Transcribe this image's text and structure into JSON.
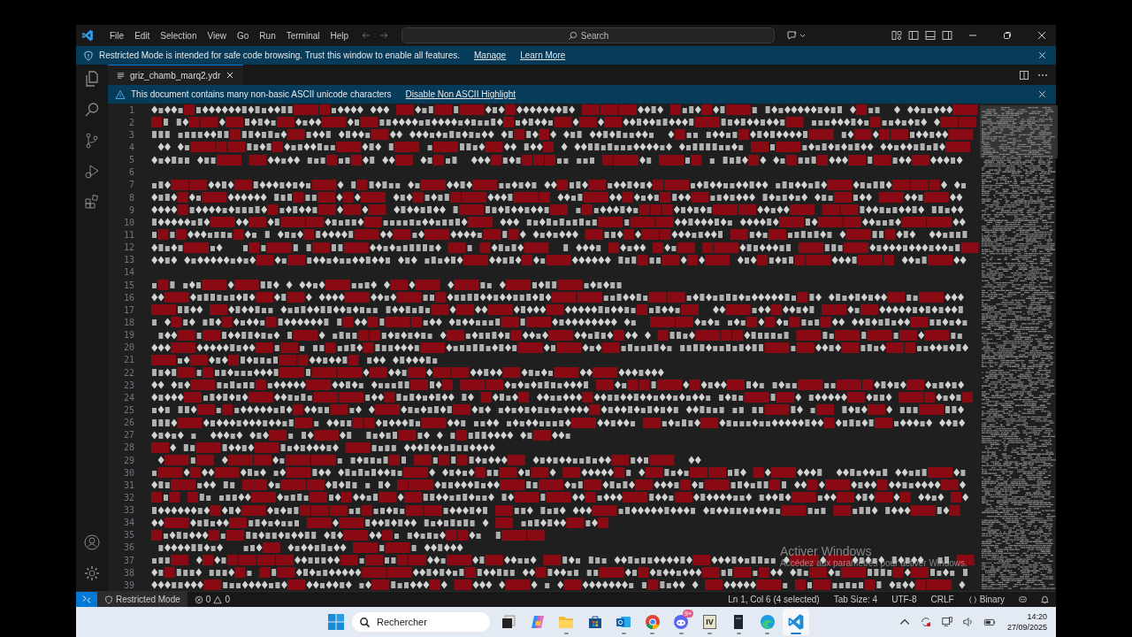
{
  "menu": [
    "File",
    "Edit",
    "Selection",
    "View",
    "Go",
    "Run",
    "Terminal",
    "Help"
  ],
  "search": {
    "placeholder": "Search"
  },
  "restricted_banner": {
    "text": "Restricted Mode is intended for safe code browsing. Trust this window to enable all features.",
    "links": [
      "Manage",
      "Learn More"
    ]
  },
  "tabs": [
    {
      "label": "griz_chamb_marq2.ydr",
      "selected": true
    }
  ],
  "ascii_banner": {
    "text": "This document contains many non-basic ASCII unicode characters",
    "link": "Disable Non ASCII Highlight"
  },
  "editor": {
    "lines": [
      {
        "number": "1",
        "kind": "full"
      },
      {
        "number": "2",
        "kind": "full"
      },
      {
        "number": "3",
        "kind": "full"
      },
      {
        "number": "4",
        "kind": "full"
      },
      {
        "number": "5",
        "kind": "full"
      },
      {
        "number": "6",
        "kind": "blank"
      },
      {
        "number": "7",
        "kind": "full"
      },
      {
        "number": "8",
        "kind": "full"
      },
      {
        "number": "9",
        "kind": "full"
      },
      {
        "number": "10",
        "kind": "full"
      },
      {
        "number": "11",
        "kind": "full"
      },
      {
        "number": "12",
        "kind": "full"
      },
      {
        "number": "13",
        "kind": "full"
      },
      {
        "number": "14",
        "kind": "blank"
      },
      {
        "number": "15",
        "kind": "short"
      },
      {
        "number": "16",
        "kind": "full"
      },
      {
        "number": "17",
        "kind": "full"
      },
      {
        "number": "18",
        "kind": "full"
      },
      {
        "number": "19",
        "kind": "full"
      },
      {
        "number": "20",
        "kind": "full"
      },
      {
        "number": "21",
        "kind": "short"
      },
      {
        "number": "22",
        "kind": "short"
      },
      {
        "number": "23",
        "kind": "full"
      },
      {
        "number": "24",
        "kind": "full"
      },
      {
        "number": "25",
        "kind": "full"
      },
      {
        "number": "26",
        "kind": "full"
      },
      {
        "number": "27",
        "kind": "short"
      },
      {
        "number": "28",
        "kind": "short"
      },
      {
        "number": "29",
        "kind": "short"
      },
      {
        "number": "30",
        "kind": "full"
      },
      {
        "number": "31",
        "kind": "full"
      },
      {
        "number": "32",
        "kind": "full"
      },
      {
        "number": "33",
        "kind": "full"
      },
      {
        "number": "34",
        "kind": "short"
      },
      {
        "number": "35",
        "kind": "short"
      },
      {
        "number": "36",
        "kind": "short"
      },
      {
        "number": "37",
        "kind": "full"
      },
      {
        "number": "38",
        "kind": "full"
      },
      {
        "number": "39",
        "kind": "full"
      }
    ]
  },
  "activation_notice": {
    "title": "Activer Windows",
    "text": "Accédez aux paramètres pour activer Windows."
  },
  "status_bar": {
    "mode": "Restricted Mode",
    "errors": "0",
    "warnings": "0",
    "items": [
      "Ln 1, Col 6 (4 selected)",
      "Tab Size: 4",
      "UTF-8",
      "CRLF",
      "Binary"
    ]
  },
  "taskbar": {
    "search_placeholder": "Rechercher",
    "apps": [
      {
        "kind": "taskview",
        "open": false,
        "selected": false
      },
      {
        "kind": "copilot",
        "open": false,
        "selected": false
      },
      {
        "kind": "folder",
        "open": true,
        "selected": false
      },
      {
        "kind": "store",
        "open": false,
        "selected": false
      },
      {
        "kind": "mail",
        "open": true,
        "selected": false
      },
      {
        "kind": "chrome",
        "open": true,
        "selected": false
      },
      {
        "kind": "discord",
        "open": true,
        "selected": false,
        "badge": "9+"
      },
      {
        "kind": "lettered",
        "label": "IV",
        "open": true,
        "selected": false
      },
      {
        "kind": "dark",
        "open": true,
        "selected": false
      },
      {
        "kind": "edge",
        "open": true,
        "selected": false
      },
      {
        "kind": "vscode",
        "open": true,
        "selected": true
      }
    ],
    "time": "14:20",
    "date": "27/09/2025"
  }
}
